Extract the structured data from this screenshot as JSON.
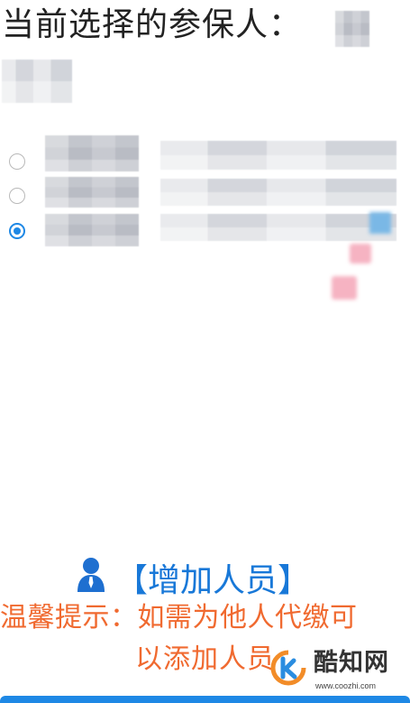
{
  "header": {
    "current_label": "当前选择的参保人："
  },
  "people": [
    {
      "selected": false
    },
    {
      "selected": false
    },
    {
      "selected": true
    }
  ],
  "add_person": {
    "icon": "person-icon",
    "label": "【增加人员】"
  },
  "tip": {
    "line1": "温馨提示：如需为他人代缴可",
    "line2": "以添加人员"
  },
  "watermark": {
    "name": "酷知网",
    "url": "www.coozhi.com"
  },
  "colors": {
    "accent": "#1e88e5",
    "link": "#1878d8",
    "tip": "#f06a30"
  }
}
